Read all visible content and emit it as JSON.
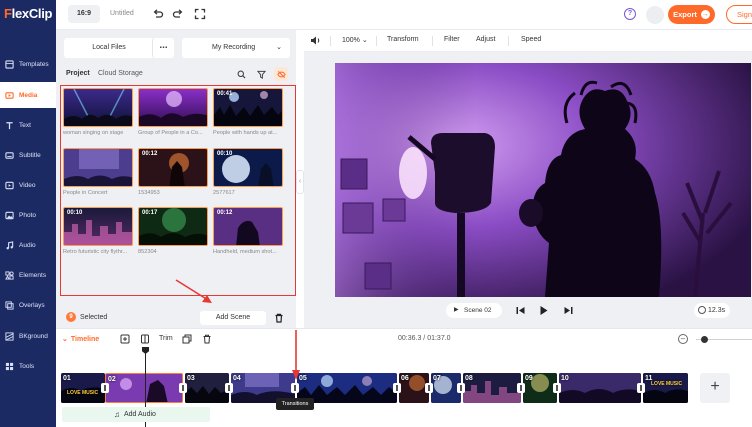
{
  "app": {
    "logo_prefix": "F",
    "logo_rest": "lexClip",
    "ratio": "16:9",
    "doc_title": "Untitled",
    "help_label": "?",
    "export_label": "Export",
    "sign_label": "Sign"
  },
  "sidebar": {
    "items": [
      {
        "label": "Templates",
        "icon": "templates-icon"
      },
      {
        "label": "Media",
        "icon": "media-icon"
      },
      {
        "label": "Text",
        "icon": "text-icon"
      },
      {
        "label": "Subtitle",
        "icon": "subtitle-icon"
      },
      {
        "label": "Video",
        "icon": "video-icon"
      },
      {
        "label": "Photo",
        "icon": "photo-icon"
      },
      {
        "label": "Audio",
        "icon": "audio-icon"
      },
      {
        "label": "Elements",
        "icon": "elements-icon"
      },
      {
        "label": "Overlays",
        "icon": "overlays-icon"
      },
      {
        "label": "BKground",
        "icon": "background-icon"
      },
      {
        "label": "Tools",
        "icon": "tools-icon"
      }
    ],
    "active": "Media"
  },
  "panel": {
    "tab_local": "Local Files",
    "tab_more": "...",
    "tab_recording": "My Recording",
    "sub_project": "Project",
    "sub_cloud": "Cloud Storage",
    "thumbs": [
      {
        "duration": "",
        "caption": "woman singing on stage"
      },
      {
        "duration": "",
        "caption": "Group of People in a Co..."
      },
      {
        "duration": "00:41",
        "caption": "People with hands up at..."
      },
      {
        "duration": "",
        "caption": "People in Concert"
      },
      {
        "duration": "00:12",
        "caption": "1534953"
      },
      {
        "duration": "00:10",
        "caption": "2577617"
      },
      {
        "duration": "00:10",
        "caption": "Retro futuristic city flythr..."
      },
      {
        "duration": "00:17",
        "caption": "852304"
      },
      {
        "duration": "00:12",
        "caption": "Handheld, medium shot..."
      }
    ],
    "selected_count": "9",
    "selected_label": "Selected",
    "add_scene": "Add Scene"
  },
  "editor": {
    "zoom": "100%",
    "transform": "Transform",
    "filter": "Filter",
    "adjust": "Adjust",
    "speed": "Speed",
    "scene_label": "Scene",
    "scene_number": "02",
    "duration": "12.3s"
  },
  "timeline": {
    "label": "Timeline",
    "trim": "Trim",
    "time": "00:36.3 / 01:37.0",
    "add_audio": "Add Audio",
    "tooltip": "Transitions",
    "clips": [
      "01",
      "02",
      "03",
      "04",
      "05",
      "06",
      "07",
      "08",
      "09",
      "10",
      "11"
    ],
    "clip_texts": {
      "c01": "LOVE MUSIC",
      "c11": "LOVE MUSIC"
    }
  },
  "colors": {
    "sidebar": "#1c2a64",
    "accent": "#ff6a2b",
    "annotation": "#e53935",
    "panel": "#eef0f4"
  }
}
